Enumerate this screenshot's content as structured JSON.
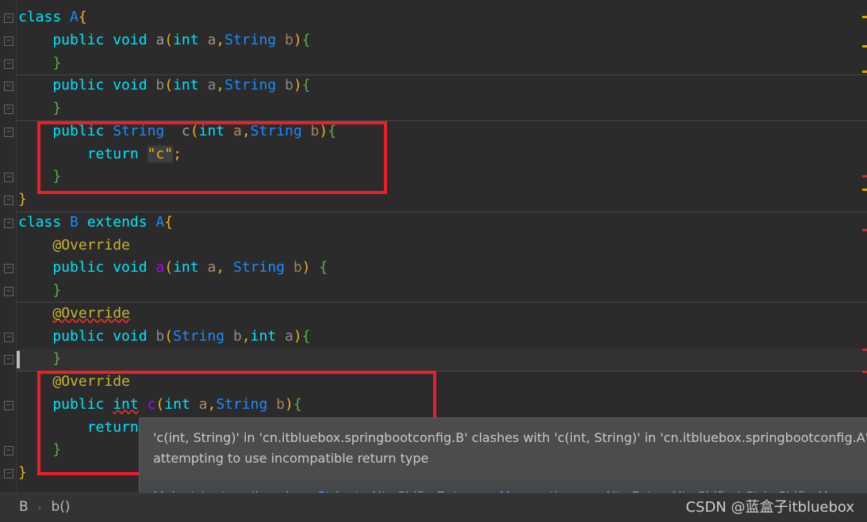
{
  "editor": {
    "lines": [
      [
        [
          "class ",
          "kw"
        ],
        [
          "A",
          "ty"
        ],
        [
          "{",
          "br"
        ]
      ],
      [
        [
          "    public void ",
          "kw"
        ],
        [
          "a",
          "mn"
        ],
        [
          "(",
          "br"
        ],
        [
          "int ",
          "kw"
        ],
        [
          "a",
          "pa"
        ],
        [
          ",",
          "br"
        ],
        [
          "String ",
          "ty"
        ],
        [
          "b",
          "pb"
        ],
        [
          ")",
          "br"
        ],
        [
          "{",
          "cb"
        ]
      ],
      [
        [
          "    }",
          "cb"
        ]
      ],
      [
        [
          "    public void ",
          "kw"
        ],
        [
          "b",
          "mn2"
        ],
        [
          "(",
          "br"
        ],
        [
          "int ",
          "kw"
        ],
        [
          "a",
          "mn2"
        ],
        [
          ",",
          "br"
        ],
        [
          "String ",
          "ty"
        ],
        [
          "b",
          "mn2"
        ],
        [
          ")",
          "br"
        ],
        [
          "{",
          "cb"
        ]
      ],
      [
        [
          "    }",
          "cb"
        ]
      ],
      [
        [
          "    public ",
          "kw"
        ],
        [
          "String  ",
          "ty"
        ],
        [
          "c",
          "mn"
        ],
        [
          "(",
          "br"
        ],
        [
          "int ",
          "kw"
        ],
        [
          "a",
          "pa"
        ],
        [
          ",",
          "br"
        ],
        [
          "String ",
          "ty"
        ],
        [
          "b",
          "pb"
        ],
        [
          ")",
          "br"
        ],
        [
          "{",
          "cb"
        ]
      ],
      [
        [
          "        return ",
          "kw"
        ],
        [
          "\"c\"",
          "st"
        ],
        [
          ";",
          "br"
        ]
      ],
      [
        [
          "    }",
          "cb"
        ]
      ],
      [
        [
          "}",
          "br"
        ]
      ],
      [
        [
          "class ",
          "kw"
        ],
        [
          "B ",
          "ty"
        ],
        [
          "extends ",
          "kw"
        ],
        [
          "A",
          "ty"
        ],
        [
          "{",
          "br"
        ]
      ],
      [
        [
          "    ",
          "tx"
        ],
        [
          "@Override",
          "an"
        ]
      ],
      [
        [
          "    public void ",
          "kw"
        ],
        [
          "a",
          "mp"
        ],
        [
          "(",
          "br"
        ],
        [
          "int ",
          "kw"
        ],
        [
          "a",
          "pa"
        ],
        [
          ", ",
          "br"
        ],
        [
          "String ",
          "ty"
        ],
        [
          "b",
          "pb"
        ],
        [
          ") ",
          "br"
        ],
        [
          "{",
          "cb"
        ]
      ],
      [
        [
          "    }",
          "cb"
        ]
      ],
      [
        [
          "    ",
          "tx"
        ],
        [
          "@Override",
          "an err"
        ]
      ],
      [
        [
          "    public void ",
          "kw"
        ],
        [
          "b",
          "mn2"
        ],
        [
          "(",
          "br"
        ],
        [
          "String ",
          "ty"
        ],
        [
          "b",
          "mn2"
        ],
        [
          ",",
          "br"
        ],
        [
          "int ",
          "kw"
        ],
        [
          "a",
          "mn2"
        ],
        [
          ")",
          "br"
        ],
        [
          "{",
          "cb"
        ]
      ],
      [
        [
          "    }",
          "cb"
        ]
      ],
      [
        [
          "    ",
          "tx"
        ],
        [
          "@Override",
          "an"
        ]
      ],
      [
        [
          "    public ",
          "kw"
        ],
        [
          "int",
          "kw err"
        ],
        [
          " ",
          "tx"
        ],
        [
          "c",
          "mp"
        ],
        [
          "(",
          "br"
        ],
        [
          "int ",
          "kw"
        ],
        [
          "a",
          "pa"
        ],
        [
          ",",
          "br"
        ],
        [
          "String ",
          "ty"
        ],
        [
          "b",
          "pb"
        ],
        [
          ")",
          "br"
        ],
        [
          "{",
          "cb"
        ]
      ],
      [
        [
          "        return",
          "kw"
        ]
      ],
      [
        [
          "    }",
          "cb"
        ]
      ],
      [
        [
          "}",
          "br"
        ]
      ]
    ]
  },
  "tooltip": {
    "message_line1": "'c(int, String)' in 'cn.itbluebox.springbootconfig.B' clashes with 'c(int, String)' in 'cn.itbluebox.springbootconfig.A'",
    "message_line2": "attempting to use incompatible return type",
    "fix_label": "Make 'c' return 'java.lang.String'",
    "fix_shortcut": "Alt+Shift+Enter",
    "more_label": "More actions...",
    "more_shortcut": "Alt+Enter Alt+Shift+I Ctrl+Shift+M"
  },
  "breadcrumb": {
    "class": "B",
    "method": "b()"
  },
  "watermark": "CSDN @蓝盒子itbluebox",
  "colors": {
    "highlight_box": "#e8202a",
    "link": "#589df6"
  }
}
